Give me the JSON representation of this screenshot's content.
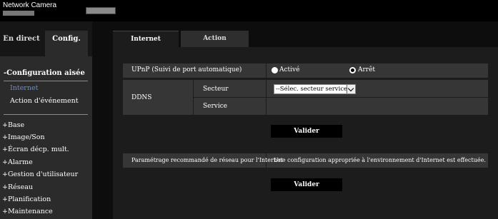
{
  "header": {
    "brand": "Network Camera"
  },
  "mode_tabs": {
    "live": "En direct",
    "config": "Config."
  },
  "sidebar": {
    "heading": "-Configuration aisée",
    "sub_items": [
      "Internet",
      "Action d'événement"
    ],
    "items": [
      "+Base",
      "+Image/Son",
      "+Écran décp. mult.",
      "+Alarme",
      "+Gestion d'utilisateur",
      "+Réseau",
      "+Planification",
      "+Maintenance"
    ]
  },
  "tabs": [
    "Internet",
    "Action d'événement"
  ],
  "form": {
    "upnp_label": "UPnP (Suivi de port automatique)",
    "upnp_options": [
      "Activé",
      "Arrêt"
    ],
    "upnp_selected": "Arrêt",
    "ddns_label": "DDNS",
    "sector_label": "Secteur",
    "sector_value": "--Sélec. secteur service--",
    "service_label": "Service",
    "apply_label": "Valider",
    "recommended_label": "Paramétrage recommandé de réseau pour l'Internet",
    "recommended_text": "Une configuration appropriée à l'environnement d'Internet est effectuée.",
    "apply2_label": "Valider"
  }
}
